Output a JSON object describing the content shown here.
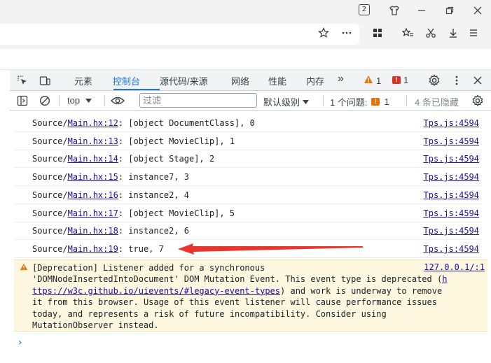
{
  "browser": {
    "tab_count": "2",
    "icons": [
      "tab-count-icon",
      "shirt-icon",
      "minimize-icon",
      "restore-icon",
      "close-icon",
      "star-icon",
      "more-icon",
      "apps-icon",
      "favorites-icon",
      "scissors-icon",
      "download-icon",
      "menu-icon"
    ]
  },
  "devtools": {
    "tabs": [
      {
        "label": "元素"
      },
      {
        "label": "控制台"
      },
      {
        "label": "源代码/来源"
      },
      {
        "label": "网络"
      },
      {
        "label": "性能"
      },
      {
        "label": "内存"
      }
    ],
    "more_tabs": "»",
    "warning_count": "1",
    "error_count": "1",
    "toolbar": {
      "context": "top",
      "filter_placeholder": "过滤",
      "levels": "默认级别",
      "issues_label": "1 个问题:",
      "issues_count": "1",
      "hidden": "4 条已隐藏"
    }
  },
  "console": {
    "logs": [
      {
        "prefix": "Source/",
        "file": "Main.hx:12",
        "text": ": [object DocumentClass], 0",
        "source": "Tps.js:4594"
      },
      {
        "prefix": "Source/",
        "file": "Main.hx:13",
        "text": ": [object MovieClip], 1",
        "source": "Tps.js:4594"
      },
      {
        "prefix": "Source/",
        "file": "Main.hx:14",
        "text": ": [object Stage], 2",
        "source": "Tps.js:4594"
      },
      {
        "prefix": "Source/",
        "file": "Main.hx:15",
        "text": ": instance7, 3",
        "source": "Tps.js:4594"
      },
      {
        "prefix": "Source/",
        "file": "Main.hx:16",
        "text": ": instance2, 4",
        "source": "Tps.js:4594"
      },
      {
        "prefix": "Source/",
        "file": "Main.hx:17",
        "text": ": [object MovieClip], 5",
        "source": "Tps.js:4594"
      },
      {
        "prefix": "Source/",
        "file": "Main.hx:18",
        "text": ": instance2, 6",
        "source": "Tps.js:4594"
      },
      {
        "prefix": "Source/",
        "file": "Main.hx:19",
        "text": ": true, 7",
        "source": "Tps.js:4594"
      }
    ],
    "warning": {
      "line1": "[Deprecation] Listener added for a synchronous",
      "line2a": "'DOMNodeInsertedIntoDocument' DOM Mutation Event. This event type is deprecated (",
      "line2b": "h",
      "line3a": "ttps://w3c.github.io/uievents/#legacy-event-types",
      "line3b": ") and work is underway to remove",
      "line4": "it from this browser. Usage of this event listener will cause performance issues",
      "line5": "today, and represents a risk of future incompatibility. Consider using",
      "line6": "MutationObserver instead.",
      "source": "127.0.0.1/:1"
    },
    "prompt": "›"
  },
  "colors": {
    "accent": "#1a73e8",
    "link": "#1a0dab",
    "warning_bg": "#fef7e0",
    "annotation": "#e8352e"
  }
}
